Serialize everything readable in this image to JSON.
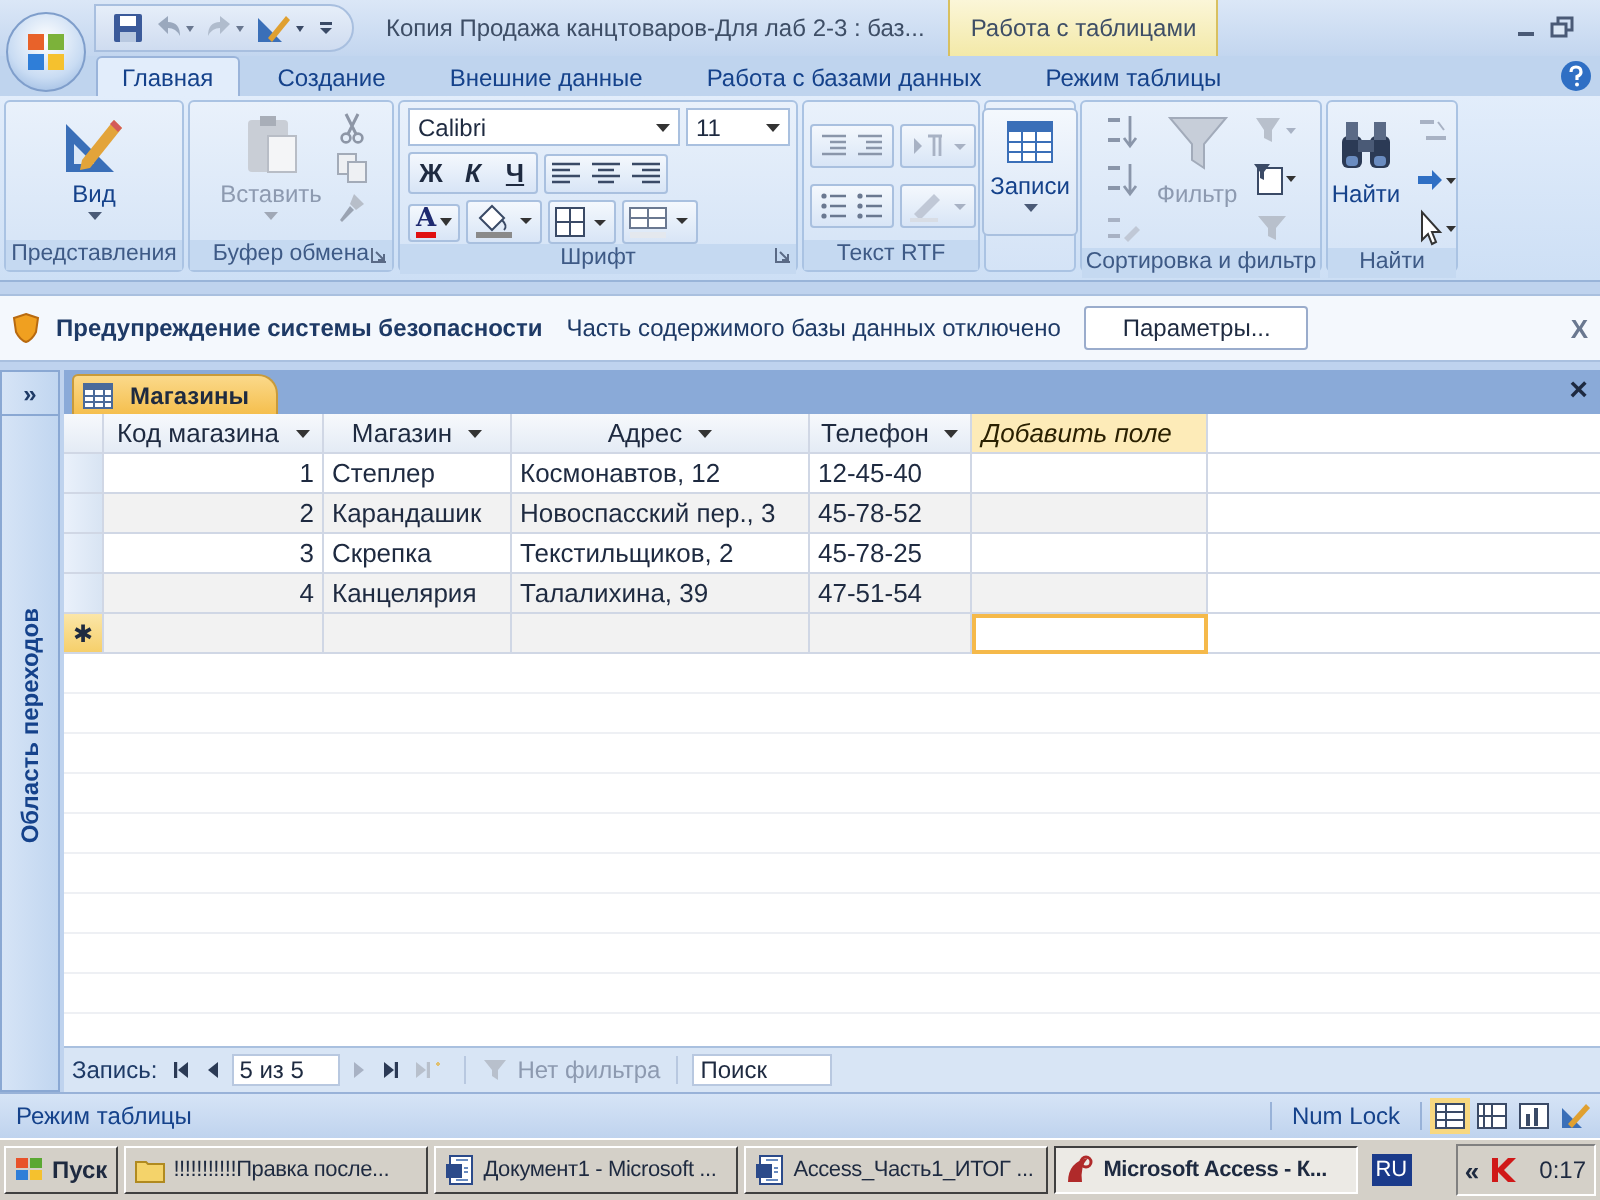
{
  "window": {
    "title": "Копия Продажа канцтоваров-Для лаб 2-3 : баз...",
    "contextual_tab": "Работа с таблицами"
  },
  "ribbon_tabs": [
    {
      "label": "Главная",
      "selected": true
    },
    {
      "label": "Создание",
      "selected": false
    },
    {
      "label": "Внешние данные",
      "selected": false
    },
    {
      "label": "Работа с базами данных",
      "selected": false
    },
    {
      "label": "Режим таблицы",
      "selected": false
    }
  ],
  "ribbon": {
    "views": {
      "label": "Представления",
      "view_button": "Вид"
    },
    "clipboard": {
      "label": "Буфер обмена",
      "paste_button": "Вставить",
      "disabled": true
    },
    "font": {
      "label": "Шрифт",
      "font_name": "Calibri",
      "font_size": "11",
      "bold": "Ж",
      "italic": "К",
      "underline": "Ч",
      "font_color": "A"
    },
    "rich_text": {
      "label": "Текст RTF"
    },
    "records": {
      "records_button": "Записи"
    },
    "sort_filter": {
      "label": "Сортировка и фильтр",
      "filter_button": "Фильтр",
      "filter_disabled": true
    },
    "find": {
      "label": "Найти",
      "find_button": "Найти"
    }
  },
  "security_bar": {
    "title": "Предупреждение системы безопасности",
    "message": "Часть содержимого базы данных отключено",
    "options_button": "Параметры...",
    "close": "X"
  },
  "navigation_pane": {
    "toggle": "»",
    "title": "Область переходов"
  },
  "document_tab": {
    "title": "Магазины",
    "close": "×"
  },
  "table": {
    "columns": [
      {
        "label": "Код магазина",
        "kind": "number"
      },
      {
        "label": "Магазин",
        "kind": "text"
      },
      {
        "label": "Адрес",
        "kind": "text"
      },
      {
        "label": "Телефон",
        "kind": "text"
      },
      {
        "label": "Добавить поле",
        "kind": "add"
      }
    ],
    "rows": [
      [
        "1",
        "Степлер",
        "Космонавтов, 12",
        "12-45-40",
        ""
      ],
      [
        "2",
        "Карандашик",
        "Новоспасский пер., 3",
        "45-78-52",
        ""
      ],
      [
        "3",
        "Скрепка",
        "Текстильщиков, 2",
        "45-78-25",
        ""
      ],
      [
        "4",
        "Канцелярия",
        "Талалихина, 39",
        "47-51-54",
        ""
      ]
    ],
    "new_row": {
      "marker": "✱",
      "cells": [
        {
          "selected": false
        },
        {
          "selected": false
        },
        {
          "selected": false
        },
        {
          "selected": false
        },
        {
          "selected": true
        }
      ]
    }
  },
  "record_navigator": {
    "label": "Запись:",
    "position": "5 из 5",
    "filter": "Нет фильтра",
    "filter_disabled": true,
    "search": {
      "placeholder": "Поиск"
    }
  },
  "status_bar": {
    "mode": "Режим таблицы",
    "num_lock": "Num Lock"
  },
  "taskbar": {
    "start": "Пуск",
    "items": [
      {
        "label": "!!!!!!!!!!!Правка после...",
        "kind": "folder",
        "selected": false
      },
      {
        "label": "Документ1 - Microsoft ...",
        "kind": "word",
        "selected": false
      },
      {
        "label": "Access_Часть1_ИТОГ ...",
        "kind": "word",
        "selected": false
      },
      {
        "label": "Microsoft Access - К...",
        "kind": "access",
        "selected": true
      }
    ],
    "language": "RU",
    "tray_toggle": "«",
    "clock": "0:17"
  }
}
